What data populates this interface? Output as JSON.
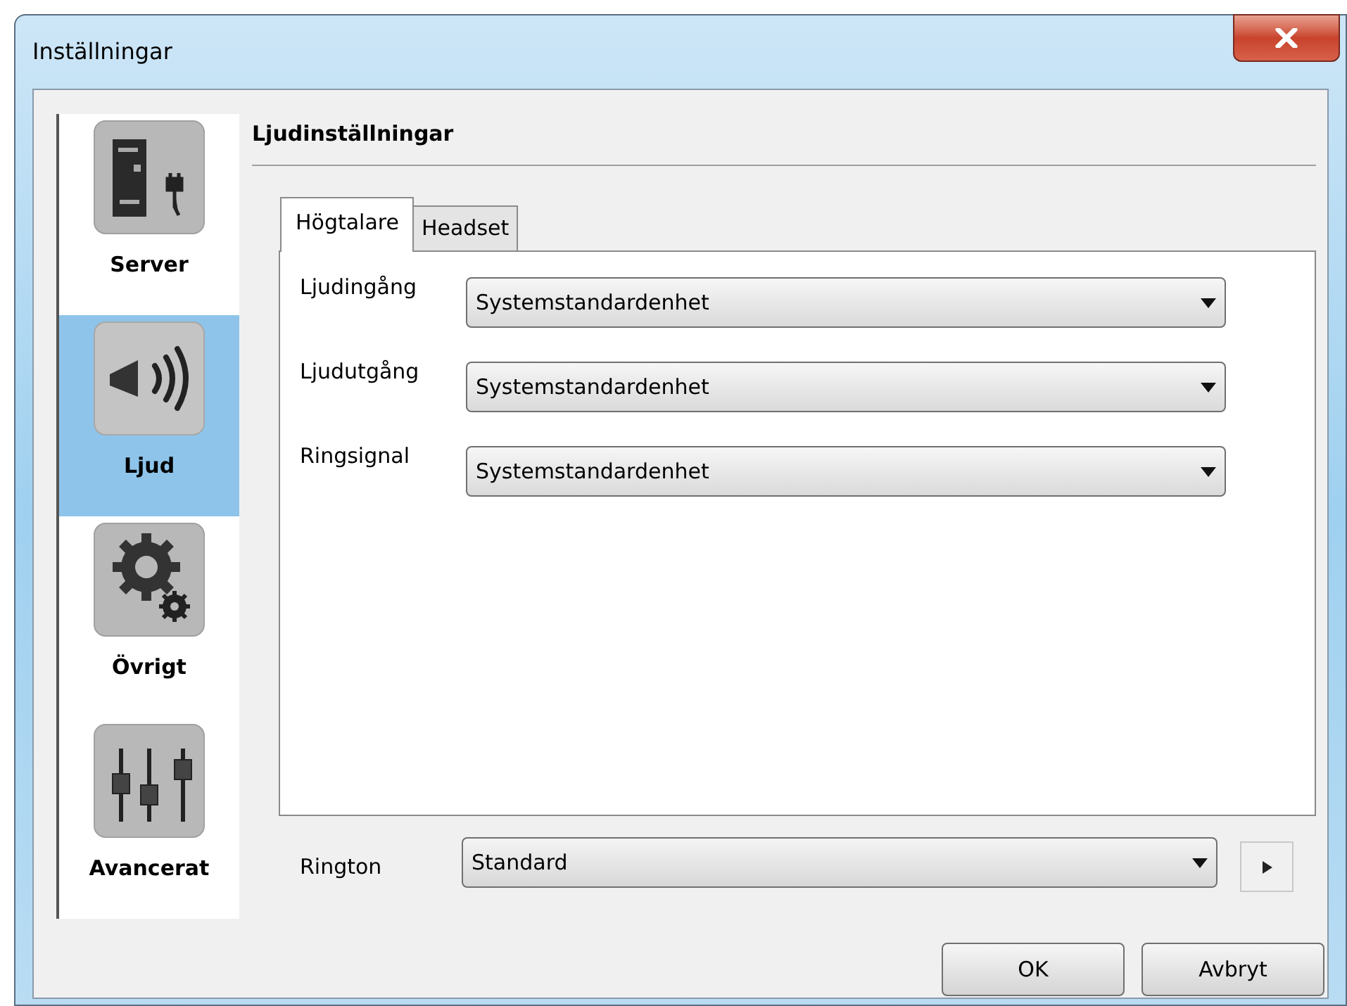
{
  "window": {
    "title": "Inställningar"
  },
  "sidebar": {
    "items": [
      {
        "label": "Server",
        "selected": false
      },
      {
        "label": "Ljud",
        "selected": true
      },
      {
        "label": "Övrigt",
        "selected": false
      },
      {
        "label": "Avancerat",
        "selected": false
      }
    ]
  },
  "section": {
    "title": "Ljudinställningar"
  },
  "tabs": [
    {
      "label": "Högtalare",
      "selected": true
    },
    {
      "label": "Headset",
      "selected": false
    }
  ],
  "device_rows": [
    {
      "label": "Ljudingång",
      "value": "Systemstandardenhet"
    },
    {
      "label": "Ljudutgång",
      "value": "Systemstandardenhet"
    },
    {
      "label": "Ringsignal",
      "value": "Systemstandardenhet"
    }
  ],
  "ringtone": {
    "label": "Rington",
    "value": "Standard"
  },
  "buttons": [
    "OK",
    "Avbryt"
  ]
}
